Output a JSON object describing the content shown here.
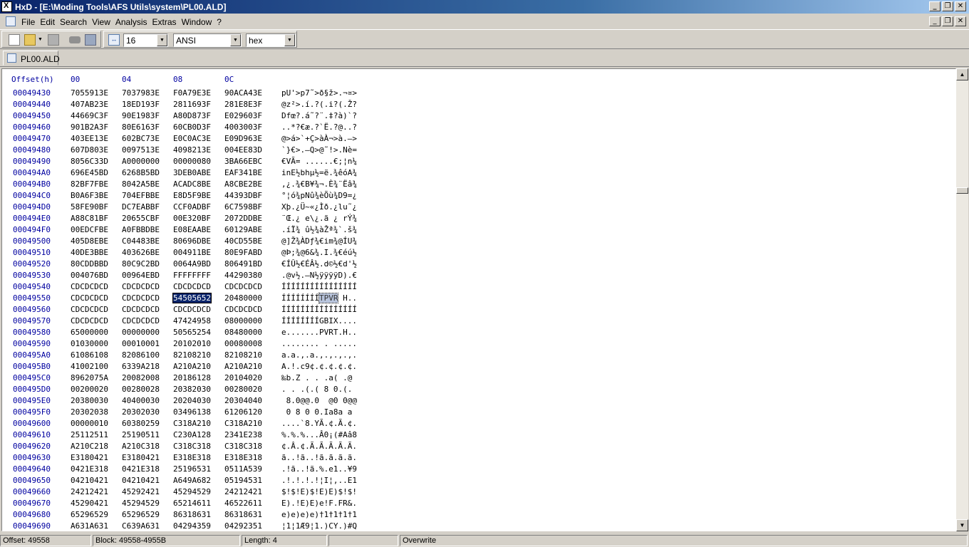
{
  "window": {
    "title": "HxD - [E:\\Moding Tools\\AFS Utils\\system\\PL00.ALD]"
  },
  "menu": [
    "File",
    "Edit",
    "Search",
    "View",
    "Analysis",
    "Extras",
    "Window",
    "?"
  ],
  "toolbar": {
    "bytes_per_row": "16",
    "charset": "ANSI",
    "offset_base": "hex"
  },
  "tab": {
    "label": "PL00.ALD"
  },
  "hex_header": {
    "offset": "Offset(h)",
    "cols": [
      "00",
      "04",
      "08",
      "0C"
    ]
  },
  "rows": [
    {
      "off": "00049430",
      "h": [
        "7055913E",
        "7037983E",
        "F0A79E3E",
        "90ACA43E"
      ],
      "a": "pU'>p7˜>ð§ž>.¬¤>"
    },
    {
      "off": "00049440",
      "h": [
        "407AB23E",
        "18ED193F",
        "2811693F",
        "281E8E3F"
      ],
      "a": "@z²>.í.?(.i?(.Ž?"
    },
    {
      "off": "00049450",
      "h": [
        "44669C3F",
        "90E1983F",
        "A80D873F",
        "E029603F"
      ],
      "a": "Dfœ?.á˜?¨.‡?à)`?"
    },
    {
      "off": "00049460",
      "h": [
        "901B2A3F",
        "80E6163F",
        "60CB0D3F",
        "4003003F"
      ],
      "a": "..*?€æ.?`Ë.?@..?"
    },
    {
      "off": "00049470",
      "h": [
        "403EE13E",
        "602BC73E",
        "E0C0AC3E",
        "E09D963E"
      ],
      "a": "@>á>`+Ç>àÀ¬>à.–>"
    },
    {
      "off": "00049480",
      "h": [
        "607D803E",
        "0097513E",
        "4098213E",
        "004EE83D"
      ],
      "a": "`}€>.—Q>@˜!>.Nè="
    },
    {
      "off": "00049490",
      "h": [
        "8056C33D",
        "A0000000",
        "00000080",
        "3BA66EBC"
      ],
      "a": "€VÃ= ......€;¦n¼"
    },
    {
      "off": "000494A0",
      "h": [
        "696E45BD",
        "6268B5BD",
        "3DEB0ABE",
        "EAF341BE"
      ],
      "a": "inE½bhµ½=ë.¾êóA¾"
    },
    {
      "off": "000494B0",
      "h": [
        "82BF7FBE",
        "8042A5BE",
        "ACADC8BE",
        "A8CBE2BE"
      ],
      "a": "‚¿.¾€B¥¾¬.È¾¨Ëâ¾"
    },
    {
      "off": "000494C0",
      "h": [
        "B0A6F3BE",
        "704EFBBE",
        "E8D5F9BE",
        "44393DBF"
      ],
      "a": "°¦ó¾pNû¾èÕù¾D9=¿"
    },
    {
      "off": "000494D0",
      "h": [
        "58FE90BF",
        "DC7EABBF",
        "CCF0ADBF",
        "6C7598BF"
      ],
      "a": "Xþ.¿Ü~«¿Ìð.¿lu˜¿"
    },
    {
      "off": "000494E0",
      "h": [
        "A88C81BF",
        "20655CBF",
        "00E320BF",
        "2072DDBE"
      ],
      "a": "¨Œ.¿ e\\¿.ã ¿ rÝ¾"
    },
    {
      "off": "000494F0",
      "h": [
        "00EDCFBE",
        "A0FBBDBE",
        "E08EAABE",
        "60129ABE"
      ],
      "a": ".íÏ¾ û½¾àŽª¾`.š¾"
    },
    {
      "off": "00049500",
      "h": [
        "405D8EBE",
        "C04483BE",
        "80696DBE",
        "40CD55BE"
      ],
      "a": "@]Ž¾ÀDƒ¾€im¾@ÍU¾"
    },
    {
      "off": "00049510",
      "h": [
        "40DE3BBE",
        "403626BE",
        "004911BE",
        "80E9FABD"
      ],
      "a": "@Þ;¾@6&¾.I.¾€éú½"
    },
    {
      "off": "00049520",
      "h": [
        "80CDDBBD",
        "80C9C2BD",
        "0064A9BD",
        "806491BD"
      ],
      "a": "€ÍÛ½€ÉÂ½.d©½€d'½"
    },
    {
      "off": "00049530",
      "h": [
        "004076BD",
        "00964EBD",
        "FFFFFFFF",
        "44290380"
      ],
      "a": ".@v½.–N½ÿÿÿÿD).€"
    },
    {
      "off": "00049540",
      "h": [
        "CDCDCDCD",
        "CDCDCDCD",
        "CDCDCDCD",
        "CDCDCDCD"
      ],
      "a": "ÍÍÍÍÍÍÍÍÍÍÍÍÍÍÍÍ"
    },
    {
      "off": "00049550",
      "h": [
        "CDCDCDCD",
        "CDCDCDCD",
        "54505652",
        "20480000"
      ],
      "a": "ÍÍÍÍÍÍÍÍTPVR H..",
      "sel": 2
    },
    {
      "off": "00049560",
      "h": [
        "CDCDCDCD",
        "CDCDCDCD",
        "CDCDCDCD",
        "CDCDCDCD"
      ],
      "a": "ÍÍÍÍÍÍÍÍÍÍÍÍÍÍÍÍ"
    },
    {
      "off": "00049570",
      "h": [
        "CDCDCDCD",
        "CDCDCDCD",
        "47424958",
        "08000000"
      ],
      "a": "ÍÍÍÍÍÍÍÍGBIX...."
    },
    {
      "off": "00049580",
      "h": [
        "65000000",
        "00000000",
        "50565254",
        "08480000"
      ],
      "a": "e.......PVRT.H.."
    },
    {
      "off": "00049590",
      "h": [
        "01030000",
        "00010001",
        "20102010",
        "00080008"
      ],
      "a": "........ . ....."
    },
    {
      "off": "000495A0",
      "h": [
        "61086108",
        "82086100",
        "82108210",
        "82108210"
      ],
      "a": "a.a.,.a.,.,.,.,."
    },
    {
      "off": "000495B0",
      "h": [
        "41002100",
        "6339A218",
        "A210A210",
        "A210A210"
      ],
      "a": "A.!.c9¢.¢.¢.¢.¢."
    },
    {
      "off": "000495C0",
      "h": [
        "8962075A",
        "20082008",
        "20186128",
        "20104020"
      ],
      "a": "‰b.Z . . .a( .@ "
    },
    {
      "off": "000495D0",
      "h": [
        "00200020",
        "00280028",
        "20382030",
        "00280020"
      ],
      "a": ". . .(.( 8 0.(. "
    },
    {
      "off": "000495E0",
      "h": [
        "20380030",
        "40400030",
        "20204030",
        "20304040"
      ],
      "a": " 8.0@@.0  @0 0@@"
    },
    {
      "off": "000495F0",
      "h": [
        "20302038",
        "20302030",
        "03496138",
        "61206120"
      ],
      "a": " 0 8 0 0.Ia8a a "
    },
    {
      "off": "00049600",
      "h": [
        "00000010",
        "60380259",
        "C318A210",
        "C318A210"
      ],
      "a": "....`8.YÃ.¢.Ã.¢."
    },
    {
      "off": "00049610",
      "h": [
        "25112511",
        "25190511",
        "C230A128",
        "2341E238"
      ],
      "a": "%.%.%...Â0¡(#Aâ8"
    },
    {
      "off": "00049620",
      "h": [
        "A210C218",
        "A210C318",
        "C318C318",
        "C318C318"
      ],
      "a": "¢.Â.¢.Ã.Ã.Ã.Ã.Ã."
    },
    {
      "off": "00049630",
      "h": [
        "E3180421",
        "E3180421",
        "E318E318",
        "E318E318"
      ],
      "a": "ã..!ã..!ã.ã.ã.ã."
    },
    {
      "off": "00049640",
      "h": [
        "0421E318",
        "0421E318",
        "25196531",
        "0511A539"
      ],
      "a": ".!ã..!ã.%.e1..¥9"
    },
    {
      "off": "00049650",
      "h": [
        "04210421",
        "04210421",
        "A649A682",
        "05194531"
      ],
      "a": ".!.!.!.!¦I¦,..E1"
    },
    {
      "off": "00049660",
      "h": [
        "24212421",
        "45292421",
        "45294529",
        "24212421"
      ],
      "a": "$!$!E)$!E)E)$!$!"
    },
    {
      "off": "00049670",
      "h": [
        "45290421",
        "45294529",
        "65214611",
        "46522611"
      ],
      "a": "E).!E)E)e!F.FR&."
    },
    {
      "off": "00049680",
      "h": [
        "65296529",
        "65296529",
        "86318631",
        "86318631"
      ],
      "a": "e)e)e)e)†1†1†1†1"
    },
    {
      "off": "00049690",
      "h": [
        "A631A631",
        "C639A631",
        "04294359",
        "04292351"
      ],
      "a": "¦1¦1Æ9¦1.)CY.)#Q"
    }
  ],
  "status": {
    "offset": "Offset: 49558",
    "block": "Block: 49558-4955B",
    "length": "Length: 4",
    "empty": "",
    "mode": "Overwrite"
  }
}
